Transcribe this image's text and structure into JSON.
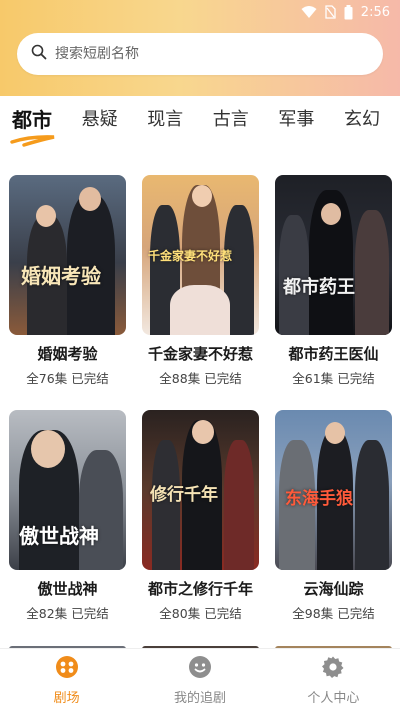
{
  "status_bar": {
    "time": "2:56"
  },
  "search": {
    "placeholder": "搜索短剧名称"
  },
  "tabs": [
    {
      "label": "都市",
      "active": true
    },
    {
      "label": "悬疑"
    },
    {
      "label": "现言"
    },
    {
      "label": "古言"
    },
    {
      "label": "军事"
    },
    {
      "label": "玄幻"
    }
  ],
  "dramas": [
    {
      "title": "婚姻考验",
      "episodes": "全76集",
      "status": "已完结",
      "poster_text": "婚姻考验"
    },
    {
      "title": "千金家妻不好惹",
      "episodes": "全88集",
      "status": "已完结",
      "poster_text": "千金家妻不好惹"
    },
    {
      "title": "都市药王医仙",
      "episodes": "全61集",
      "status": "已完结",
      "poster_text": "都市药王"
    },
    {
      "title": "傲世战神",
      "episodes": "全82集",
      "status": "已完结",
      "poster_text": "傲世战神"
    },
    {
      "title": "都市之修行千年",
      "episodes": "全80集",
      "status": "已完结",
      "poster_text": "修行千年"
    },
    {
      "title": "云海仙踪",
      "episodes": "全98集",
      "status": "已完结",
      "poster_text": "东海手狼"
    }
  ],
  "bottom_nav": [
    {
      "label": "剧场",
      "icon": "theater-icon",
      "active": true
    },
    {
      "label": "我的追剧",
      "icon": "smiley-icon"
    },
    {
      "label": "个人中心",
      "icon": "gear-icon"
    }
  ],
  "colors": {
    "accent": "#f08c1a",
    "header_gradient": [
      "#f7c96a",
      "#f6b9a9"
    ]
  }
}
